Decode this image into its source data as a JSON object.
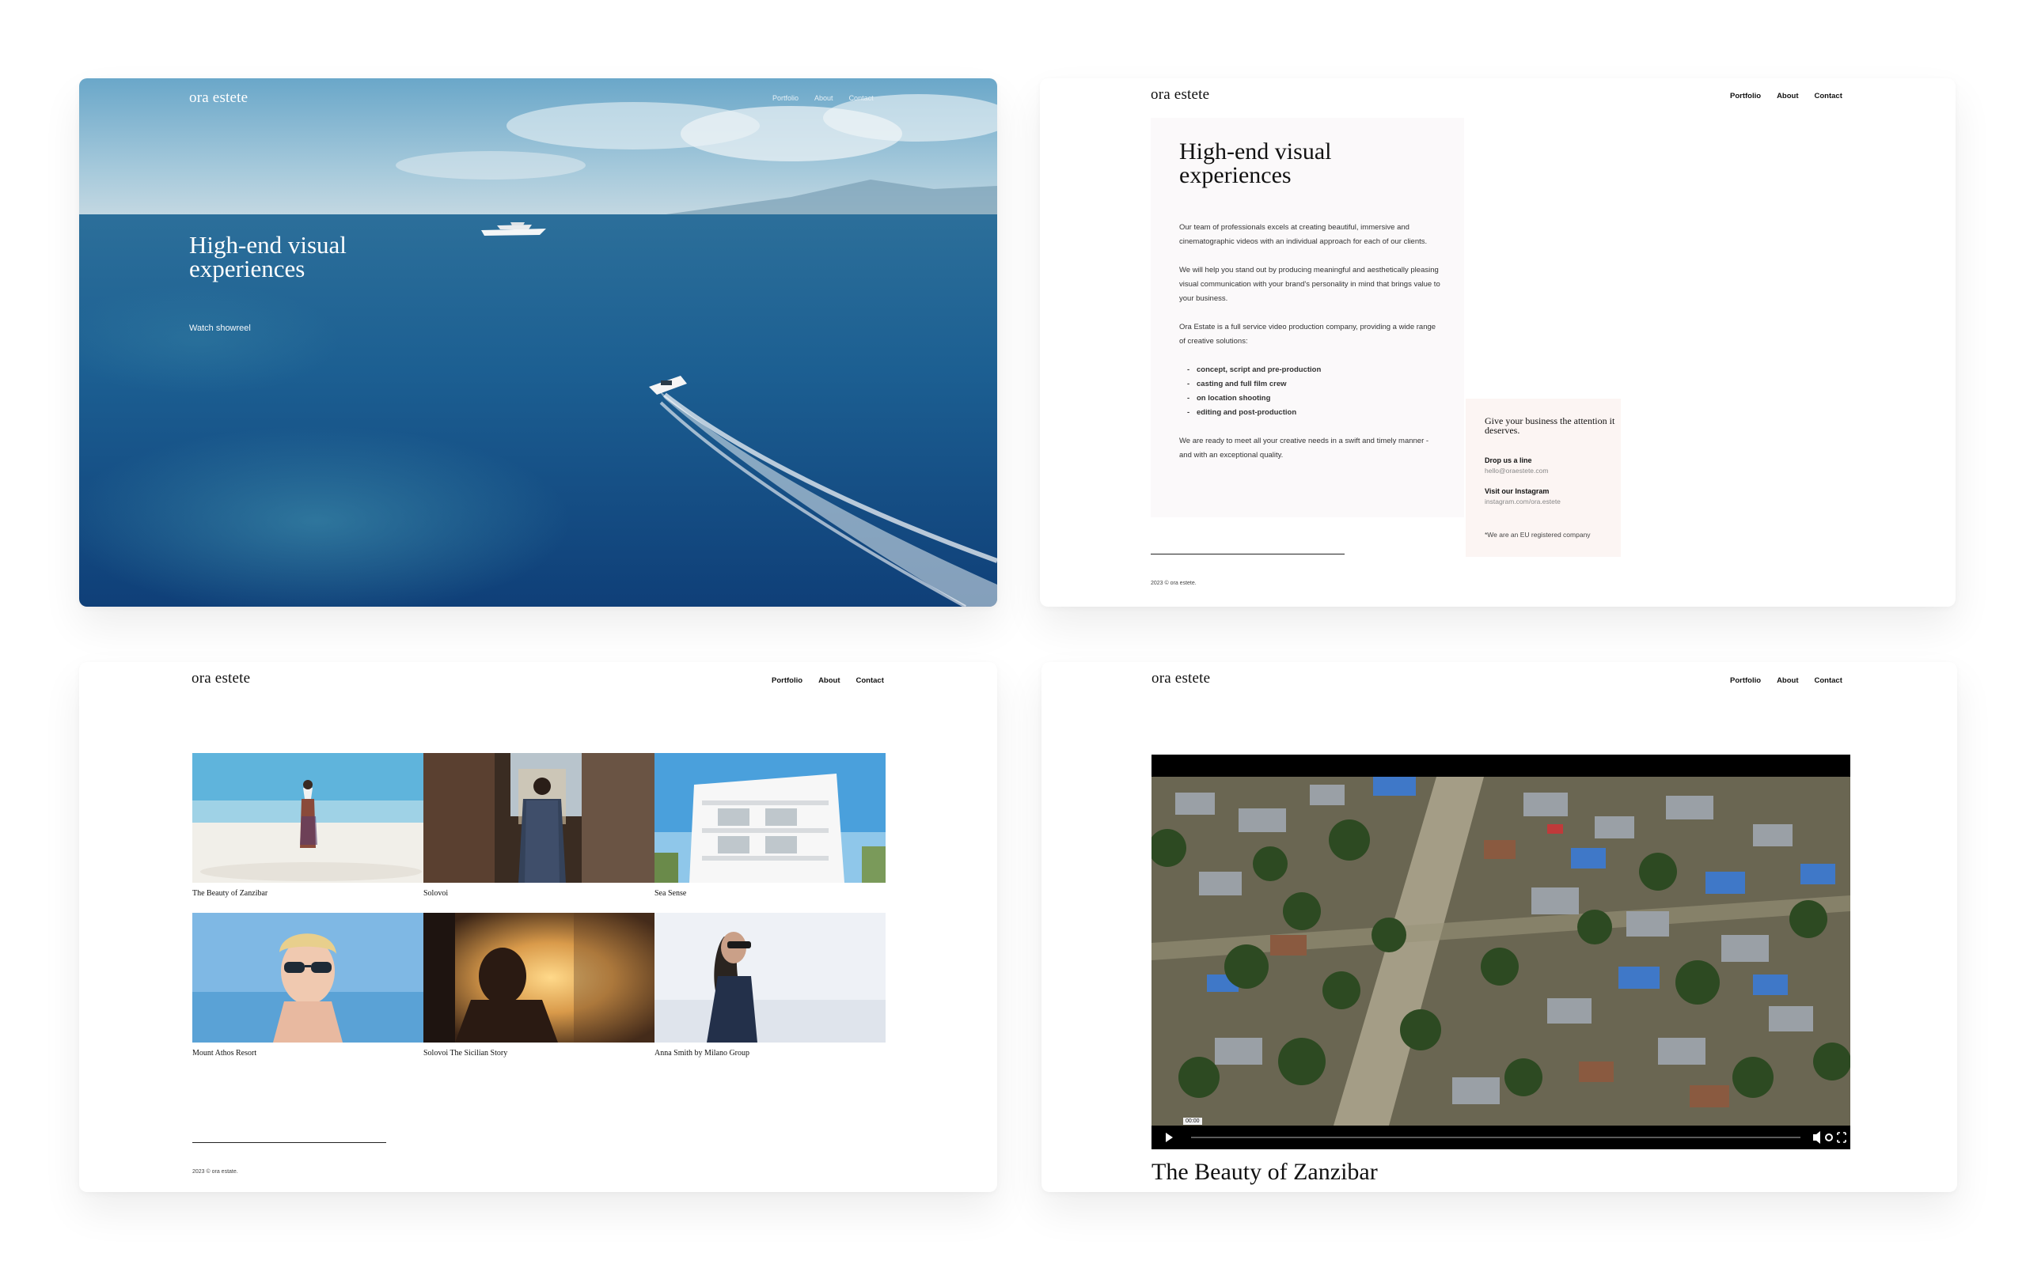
{
  "brand": "ora estete",
  "nav": [
    "Portfolio",
    "About",
    "Contact"
  ],
  "hero": {
    "title": "High-end visual experiences",
    "cta": "Watch showreel"
  },
  "about": {
    "title": "High-end visual experiences",
    "paragraphs": [
      "Our team of professionals excels at creating beautiful, immersive and cinematographic videos with an individual approach for each of our clients.",
      "We will help you stand out by producing meaningful and aesthetically pleasing visual communication with your brand's personality in mind that brings value to your business.",
      "Ora Estate is a full service video production company, providing a wide range of creative solutions:"
    ],
    "services": [
      "concept, script and pre-production",
      "casting and full film crew",
      "on location shooting",
      "editing and post-production"
    ],
    "closing": "We are ready to meet all your creative needs in a swift and timely manner - and with an exceptional quality.",
    "contact": {
      "title": "Give your business the attention it deserves.",
      "email_label": "Drop us a line",
      "email": "hello@oraestete.com",
      "instagram_label": "Visit our Instagram",
      "instagram": "instagram.com/ora.estete",
      "note": "*We are an EU registered company"
    },
    "copyright": "2023 © ora estete."
  },
  "portfolio": {
    "items": [
      "The Beauty of Zanzibar",
      "Solovoi",
      "Sea Sense",
      "Mount Athos Resort",
      "Solovoi The Sicilian Story",
      "Anna Smith by Milano Group"
    ],
    "copyright": "2023 © ora estate."
  },
  "video": {
    "title": "The Beauty of Zanzibar",
    "time": "00:00"
  }
}
